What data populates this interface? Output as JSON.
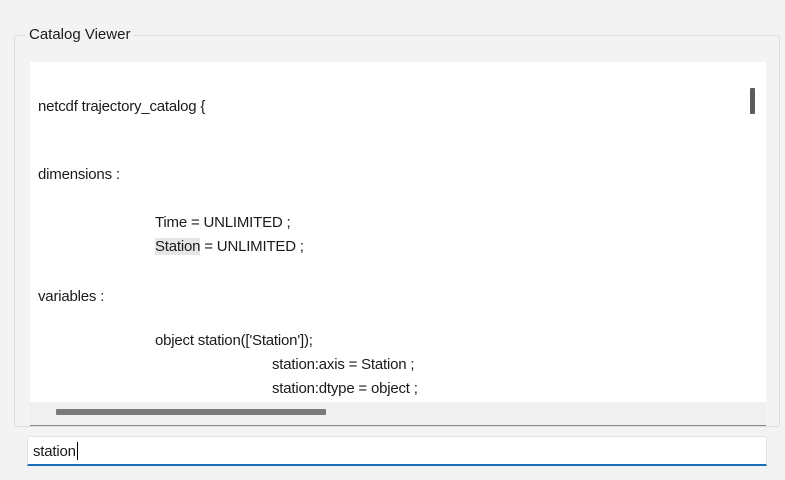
{
  "window": {
    "group_title": "Catalog Viewer"
  },
  "content": {
    "lines": [
      "netcdf trajectory_catalog {",
      "dimensions :",
      "Time = UNLIMITED ;",
      "Station",
      " = UNLIMITED ;",
      "variables :",
      "object station(['Station']);",
      "station:axis = Station ;",
      "station:dtype = object ;"
    ]
  },
  "search": {
    "value": "station"
  }
}
